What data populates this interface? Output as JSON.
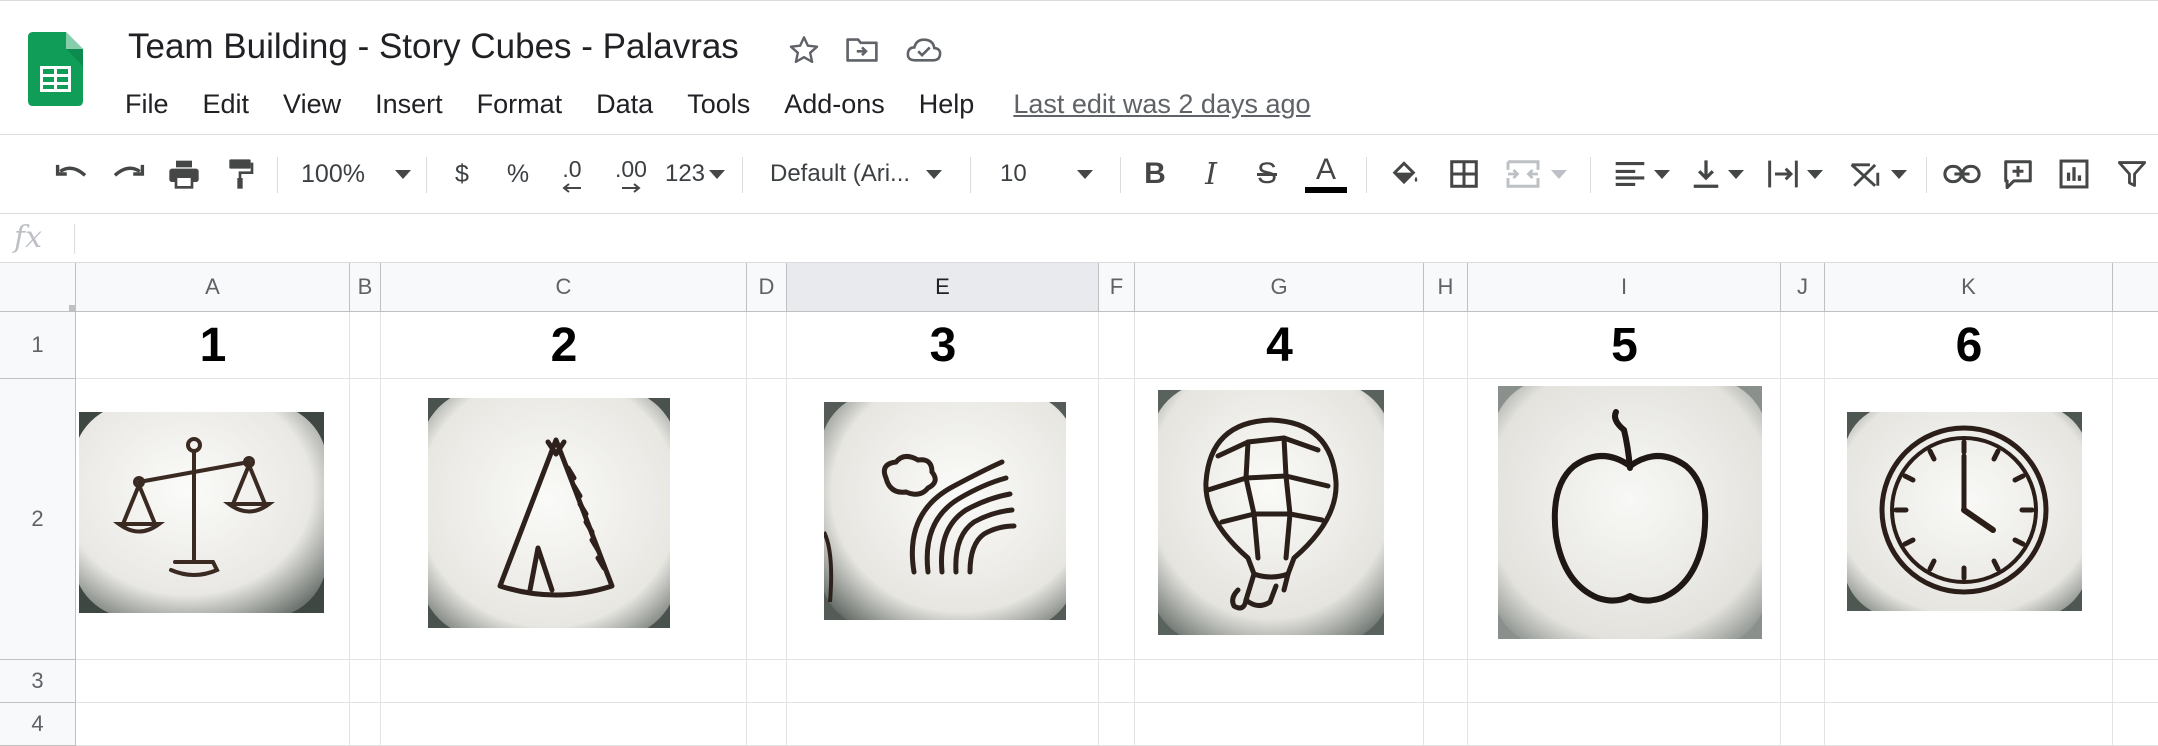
{
  "document": {
    "title": "Team Building - Story Cubes - Palavras",
    "last_edit": "Last edit was 2 days ago"
  },
  "menu": [
    "File",
    "Edit",
    "View",
    "Insert",
    "Format",
    "Data",
    "Tools",
    "Add-ons",
    "Help"
  ],
  "toolbar": {
    "zoom": "100%",
    "currency": "$",
    "percent": "%",
    "decrease_decimal": ".0",
    "increase_decimal": ".00",
    "more_formats": "123",
    "font": "Default (Ari...",
    "font_size": "10",
    "bold": "B",
    "italic": "I",
    "strike": "S",
    "text_color_label": "A",
    "text_color": "#000000"
  },
  "formula_bar": {
    "fx": "fx",
    "value": ""
  },
  "columns": [
    "A",
    "B",
    "C",
    "D",
    "E",
    "F",
    "G",
    "H",
    "I",
    "J",
    "K"
  ],
  "selected_column": "E",
  "rows": [
    "1",
    "2",
    "3",
    "4"
  ],
  "cells": {
    "A1": "1",
    "C1": "2",
    "E1": "3",
    "G1": "4",
    "I1": "5",
    "K1": "6"
  },
  "images": {
    "A2": "balance-scale-icon",
    "C2": "teepee-icon",
    "E2": "rainbow-cloud-icon",
    "G2": "hot-air-balloon-icon",
    "I2": "apple-icon",
    "K2": "clock-icon"
  },
  "colors": {
    "sheets_green": "#0f9d58",
    "grid_line": "#e2e3e3",
    "header_bg": "#f8f9fa",
    "selected_header_bg": "#e8eaed"
  }
}
